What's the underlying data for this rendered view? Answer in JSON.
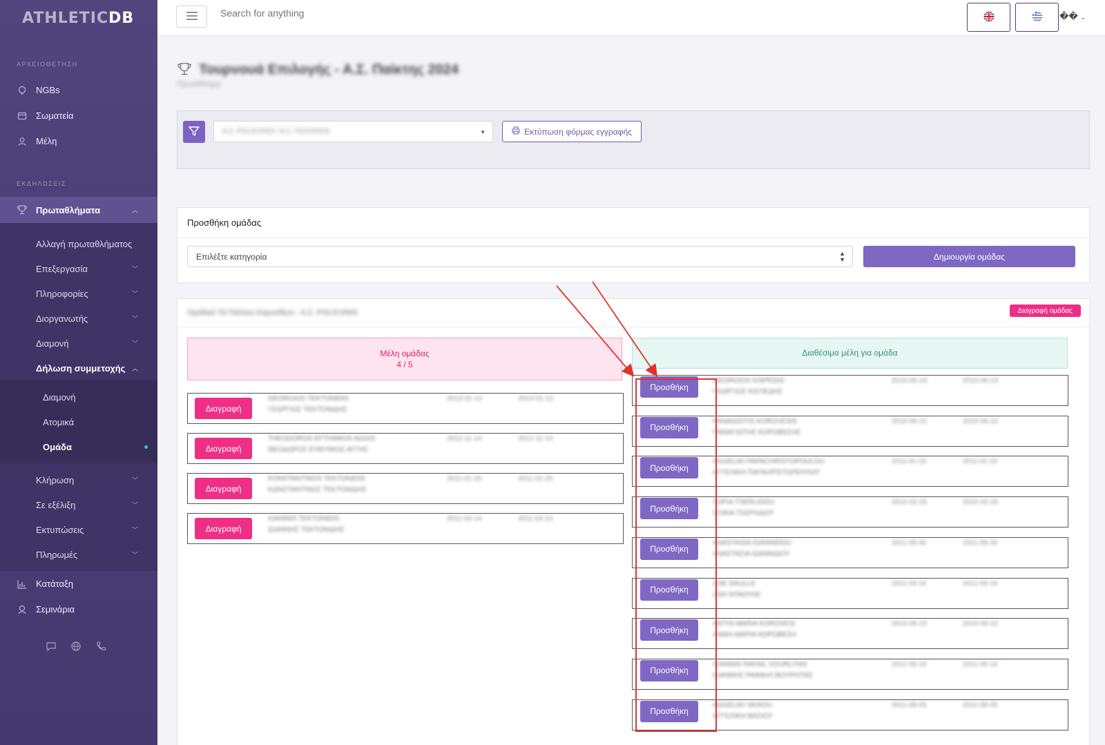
{
  "app": {
    "logo_part1": "ATHLETIC",
    "logo_part2": "DB"
  },
  "sidebar": {
    "section1": "ΑΡΧΕΙΟΘΕΤΗΣΗ",
    "section1_items": [
      {
        "label": "NGBs",
        "icon": "bulb-icon"
      },
      {
        "label": "Σωματεία",
        "icon": "folder-icon"
      },
      {
        "label": "Μέλη",
        "icon": "person-icon"
      }
    ],
    "section2": "ΕΚΔΗΛΩΣΕΙΣ",
    "active_item": {
      "label": "Πρωταθλήματα",
      "icon": "trophy-icon"
    },
    "sub_items": [
      "Αλλαγή πρωταθλήματος",
      "Επεξεργασία",
      "Πληροφορίες",
      "Διοργανωτής",
      "Διαμονή",
      "Δήλωση συμμετοχής"
    ],
    "subsub_items": [
      "Διαμονή",
      "Ατομικά",
      "Ομάδα"
    ],
    "more_items": [
      "Κλήρωση",
      "Σε εξέλιξη",
      "Εκτυπώσεις",
      "Πληρωμές"
    ],
    "bottom_items": [
      {
        "label": "Κατάταξη",
        "icon": "chart-icon"
      },
      {
        "label": "Σεμινάρια",
        "icon": "graduation-icon"
      }
    ]
  },
  "topbar": {
    "search_placeholder": "Search for anything",
    "user_label": "��"
  },
  "page": {
    "title": "Τουρνουά Επιλογής - Α.Σ. Παίκτης 2024",
    "subtitle": "Πρωτάθλημα"
  },
  "filter": {
    "selected_club": "Α.Σ. POLICHNIS / Α.Σ. ΠΟΛΙΧΝΗΣ",
    "print_label": "Εκτύπωση φόρμας εγγραφής"
  },
  "add_team": {
    "header": "Προσθήκη ομάδας",
    "category_placeholder": "Επιλέξτε κατηγορία",
    "create_label": "Δημιουργία ομάδας"
  },
  "team": {
    "title": "Ομάδικό Τεϊ Πάλλου Καρυαδίων - Α.Σ. POLICHNIS",
    "delete_team_label": "Διαγραφή ομάδας",
    "members_header": "Μέλη ομάδας",
    "members_count": "4 / 5",
    "available_header": "Διαθέσιμα μέλη για ομάδα",
    "remove_label": "Διαγραφή",
    "add_label": "Προσθήκη",
    "members": [
      {
        "name_en": "GEORGIOS TEKTONIDIS",
        "name_gr": "ΓΕΩΡΓΙΟΣ ΤΕΚΤΟΝΙΔΗΣ",
        "d1": "2013-01-12",
        "d2": "2013-01-12"
      },
      {
        "name_en": "THEODOROS EFTHIMIOS AGGIS",
        "name_gr": "ΘΕΟΔΩΡΟΣ ΕΥΘΥΜΙΟΣ ΑΓΓΗΣ",
        "d1": "2012-11-14",
        "d2": "2012-11-14"
      },
      {
        "name_en": "KONSTANTINOS TEKTONIDIS",
        "name_gr": "ΚΩΝΣΤΑΝΤΙΝΟΣ ΤΕΚΤΟΝΙΔΗΣ",
        "d1": "2011-01-25",
        "d2": "2011-01-25"
      },
      {
        "name_en": "IOANNIS TEKTONIDIS",
        "name_gr": "ΙΩΑΝΝΗΣ ΤΕΚΤΟΝΙΔΗΣ",
        "d1": "2011-04-14",
        "d2": "2011-04-14"
      }
    ],
    "available": [
      {
        "name_en": "GEORGIOS KISPEDIS",
        "name_gr": "ΓΕΩΡΓΙΟΣ ΚΙΣΠΕΔΗΣ",
        "d1": "2010-06-23",
        "d2": "2010-06-23"
      },
      {
        "name_en": "PANAGIOTIS KOROVESIS",
        "name_gr": "ΠΑΝΑΓΙΩΤΗΣ ΚΟΡΟΒΕΣΗΣ",
        "d1": "2010-06-22",
        "d2": "2010-06-22"
      },
      {
        "name_en": "AGGELIKI PAPACHRISTOPOULOU",
        "name_gr": "ΑΓΓΕΛΙΚΗ ΠΑΠΑΧΡΙΣΤΟΠΟΥΛΟΥ",
        "d1": "2011-01-22",
        "d2": "2011-01-22"
      },
      {
        "name_en": "SOFIA TSERLIDOU",
        "name_gr": "ΣΟΦΙΑ ΤΣΕΡΛΙΔΟΥ",
        "d1": "2010-02-26",
        "d2": "2010-02-26"
      },
      {
        "name_en": "ANASTASIA IOANNIDOU",
        "name_gr": "ΑΝΑΣΤΑΣΙΑ ΙΩΑΝΝΙΔΟΥ",
        "d1": "2011-09-30",
        "d2": "2011-09-30"
      },
      {
        "name_en": "ZOE DAULLE",
        "name_gr": "ΖΩΗ ΝΤΑΟΥΛΕ",
        "d1": "2011-09-16",
        "d2": "2011-09-16"
      },
      {
        "name_en": "ANTHI-MARIA KOROVESI",
        "name_gr": "ΑΝΘΗ-ΜΑΡΙΑ ΚΟΡΟΒΕΣΗ",
        "d1": "2010-06-22",
        "d2": "2010-06-22"
      },
      {
        "name_en": "IOANNIS RAFAIL VOURLITAS",
        "name_gr": "ΙΩΑΝΝΗΣ ΡΑΦΑΗΛ ΒΟΥΡΛΙΤΑΣ",
        "d1": "2011-05-16",
        "d2": "2011-05-16"
      },
      {
        "name_en": "AGGELIKI VASIOU",
        "name_gr": "ΑΓΓΕΛΙΚΗ ΒΑΣΙΟΥ",
        "d1": "2011-08-05",
        "d2": "2011-08-05"
      }
    ]
  },
  "colors": {
    "primary": "#7f68c3",
    "danger": "#ee2f85",
    "sidebar": "#4a3e76",
    "annotation": "#e3322b"
  }
}
